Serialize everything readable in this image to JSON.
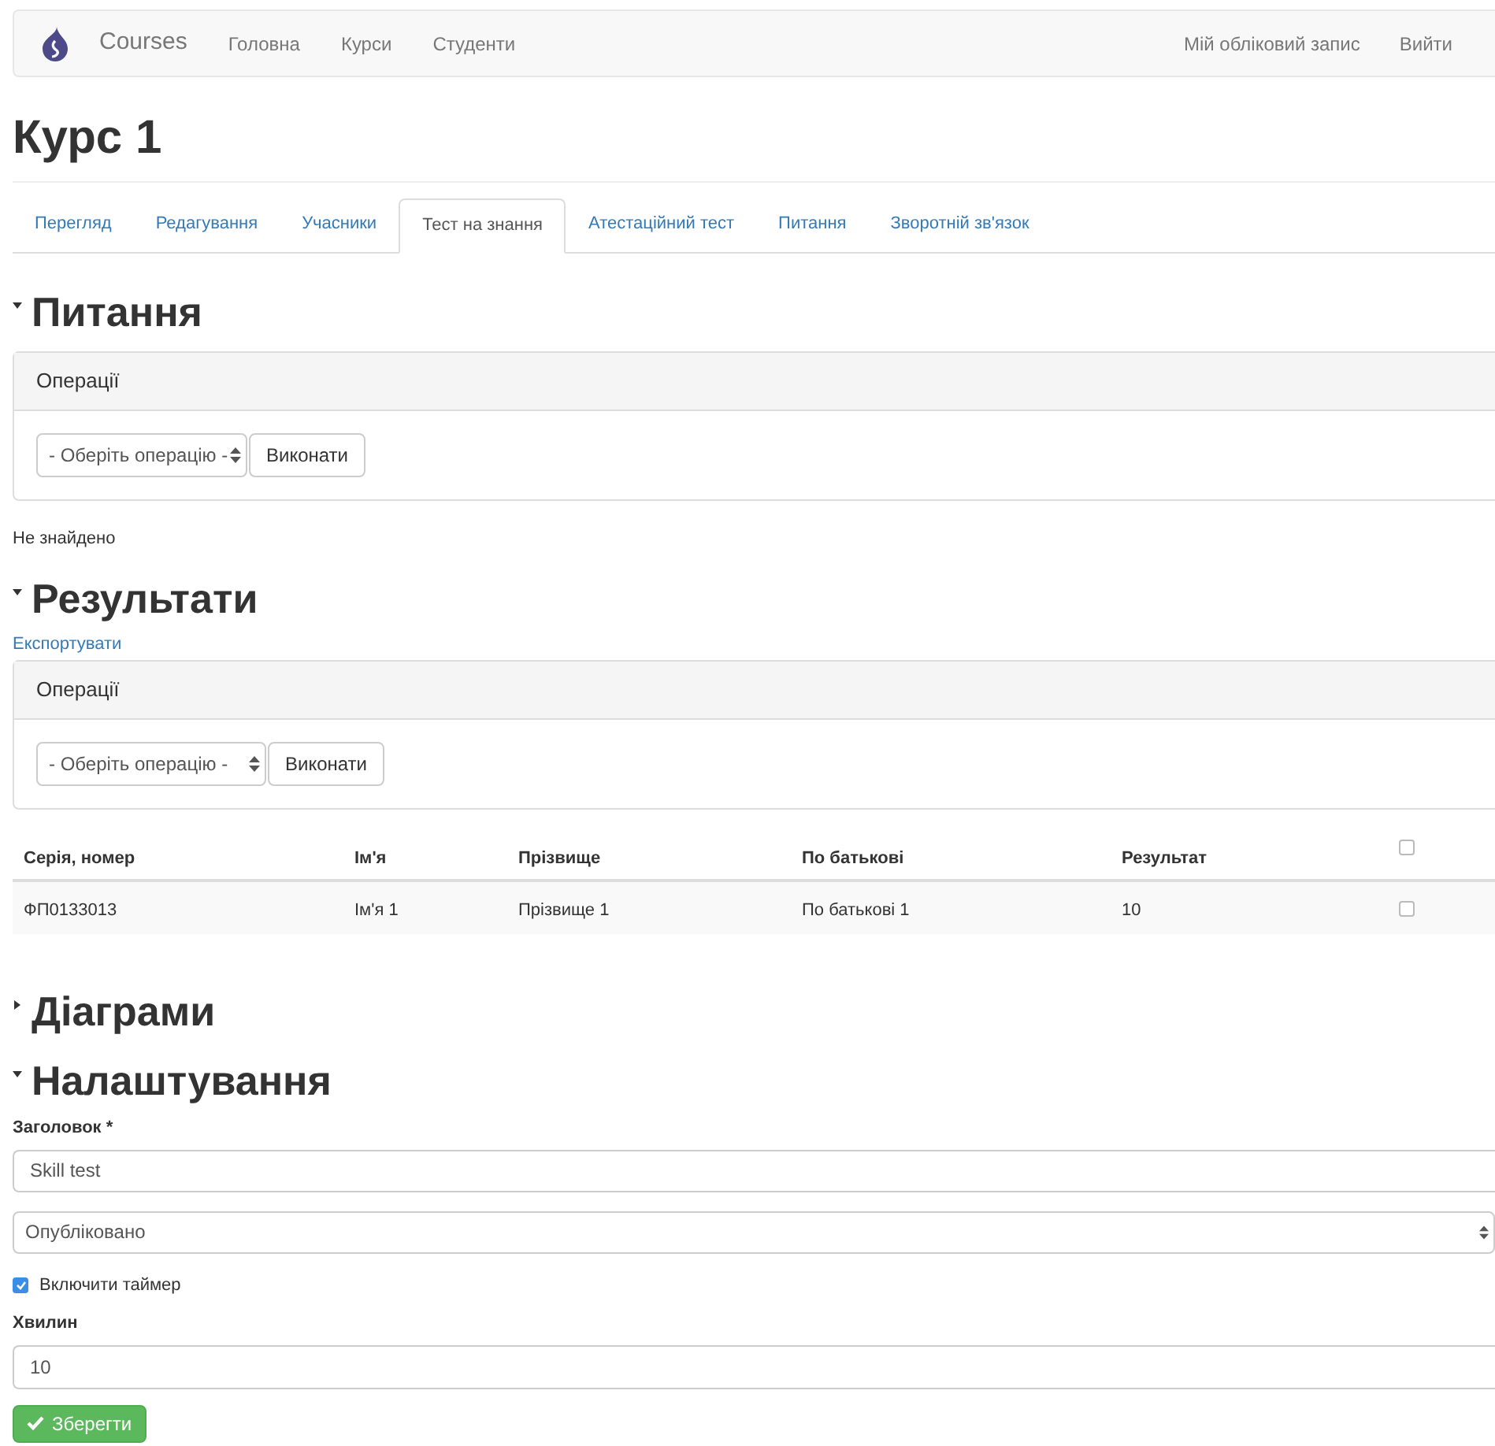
{
  "navbar": {
    "brand": "Courses",
    "links": [
      "Головна",
      "Курси",
      "Студенти"
    ],
    "right_links": [
      "Мій обліковий запис",
      "Вийти"
    ]
  },
  "page_title": "Курс 1",
  "tabs": [
    {
      "label": "Перегляд",
      "selected": false
    },
    {
      "label": "Редагування",
      "selected": false
    },
    {
      "label": "Учасники",
      "selected": false
    },
    {
      "label": "Тест на знання",
      "selected": true
    },
    {
      "label": "Атестаційний тест",
      "selected": false
    },
    {
      "label": "Питання",
      "selected": false
    },
    {
      "label": "Зворотній зв'язок",
      "selected": false
    }
  ],
  "questions": {
    "title": "Питання",
    "expanded": true,
    "operations": {
      "heading": "Операції",
      "select": "- Оберіть операцію -",
      "button": "Виконати"
    },
    "empty_text": "Не знайдено"
  },
  "results": {
    "title": "Результати",
    "expanded": true,
    "export_link": "Експортувати",
    "operations": {
      "heading": "Операції",
      "select": "- Оберіть операцію -",
      "button": "Виконати"
    },
    "table": {
      "columns": [
        "Серія, номер",
        "Ім'я",
        "Прізвище",
        "По батькові",
        "Результат"
      ],
      "select_all_checked": false,
      "rows": [
        {
          "cells": [
            "ФП0133013",
            "Ім'я 1",
            "Прізвище 1",
            "По батькові 1",
            "10"
          ],
          "checked": false
        }
      ]
    }
  },
  "charts": {
    "title": "Діаграми",
    "expanded": false
  },
  "settings": {
    "title": "Налаштування",
    "expanded": true,
    "title_label": "Заголовок *",
    "title_value": "Skill test",
    "status_value": "Опубліковано",
    "timer": {
      "label": "Включити таймер",
      "checked": true
    },
    "minutes_label": "Хвилин",
    "minutes_value": "10",
    "save_button": "Зберегти"
  }
}
